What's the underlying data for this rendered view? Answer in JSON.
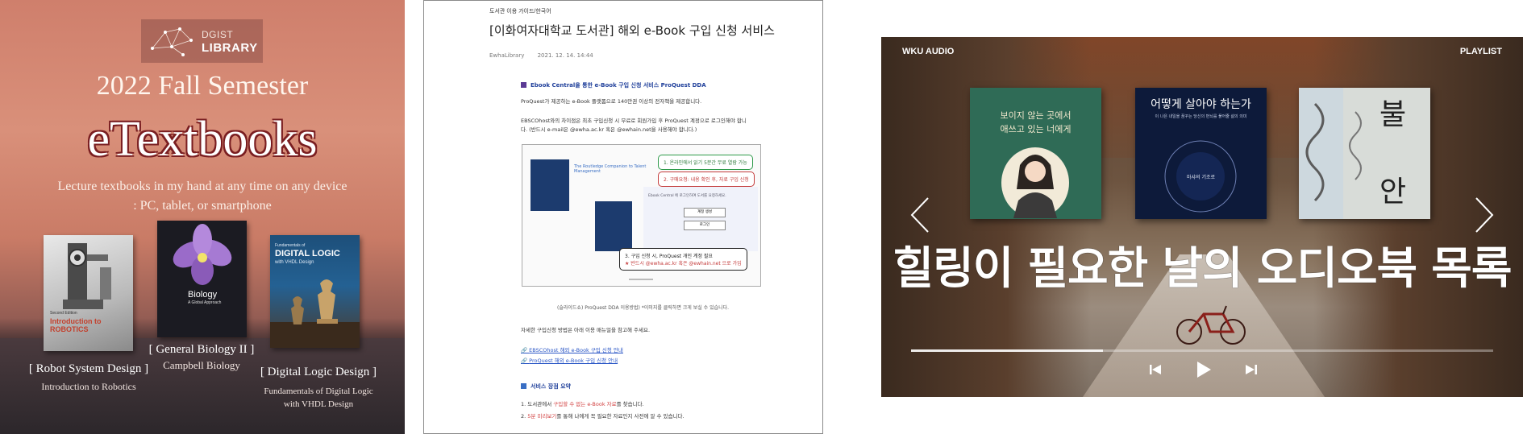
{
  "panel1": {
    "logo": {
      "line1": "DGIST",
      "line2": "LIBRARY"
    },
    "semester": "2022 Fall Semester",
    "heading": "eTextbooks",
    "subtitle_line1": "Lecture textbooks in my hand at any time on any device",
    "subtitle_line2": ": PC, tablet, or smartphone",
    "books": [
      {
        "label": "[ Robot System Design ]",
        "caption": "Introduction to Robotics",
        "cover_title": "Introduction to ROBOTICS",
        "cover_top": "Second Edition"
      },
      {
        "label": "[ General Biology II ]",
        "caption": "Campbell Biology",
        "cover_title": "Biology",
        "cover_sub": "A Global Approach"
      },
      {
        "label": "[ Digital Logic Design ]",
        "caption_line1": "Fundamentals of Digital Logic",
        "caption_line2": "with VHDL Design",
        "cover_title": "DIGITAL LOGIC",
        "cover_top": "Fundamentals of",
        "cover_sub": "with VHDL Design"
      }
    ]
  },
  "panel2": {
    "breadcrumb": "도서관 이용 가이드/한국어",
    "title": "[이화여자대학교 도서관] 해외 e-Book 구입 신청 서비스",
    "author": "EwhaLibrary",
    "date": "2021. 12. 14. 14:44",
    "section_heading": "Ebook Central을 통한 e-Book 구입 신청 서비스",
    "section_heading_brand": "ProQuest DDA",
    "para1": "ProQuest가 제공하는 e-Book 플랫폼으로 140만권 이상의 전자책을 제공합니다.",
    "para2_line1": "EBSCOhost와의 차이점은 최초 구입신청 시 무료로 회원가입 후 ProQuest 계정으로 로그인해야 합니",
    "para2_line2": "다. (반드시 e-mail은 @ewha.ac.kr 혹은 @ewhain.net을 사용해야 합니다.)",
    "figure": {
      "book_title": "The Routledge Companion to Talent Management",
      "callout1": "1. 온라인에서 읽기 5분간 무료 열람 가능",
      "callout2": "2. 구매요청: 내용 확인 후, 자료 구입 신청",
      "callout3_line1": "3. 구입 신청 시, ProQuest 개인 계정 필요",
      "callout3_line2": "★ 반드시 @ewha.ac.kr 혹은 @ewhain.net 으로 가입",
      "login_note": "Ebook Central 에 로그인하여 도서를 요청하세요.",
      "btn_login": "계정 생성",
      "btn_signup": "로그인"
    },
    "caption": "(슬라이드쇼) ProQuest DDA 이용방법) *이미지를 클릭하면 크게 보실 수 있습니다.",
    "more": "자세한 구입신청 방법은 아래 이용 매뉴얼을 참고해 주세요.",
    "link1": "EBSCOhost 해외 e-Book 구입 신청 안내",
    "link2": "ProQuest 해외 e-Book 구입 신청 안내",
    "summary_heading": "서비스 장점 요약",
    "summary1_a": "1. 도서관에서 ",
    "summary1_b": "구입할 수 없는 e-Book 자료",
    "summary1_c": "를 찾습니다.",
    "summary2_a": "2. ",
    "summary2_b": "5분 미리보기",
    "summary2_c": "를 통해 나에게 꼭 필요한 자료인지 사전에 알 수 있습니다."
  },
  "panel3": {
    "brand": "WKU AUDIO",
    "playlist": "PLAYLIST",
    "heading": "힐링이 필요한 날의 오디오북 목록",
    "covers": [
      {
        "line1": "보이지 않는 곳에서",
        "line2": "애쓰고 있는 너에게"
      },
      {
        "title": "어떻게 살아야 하는가",
        "sub": "이 나은 내일을 꿈꾸는 당신의 번뇌를 풀어줄 삶의 의미",
        "author": "마샤의 기조로"
      },
      {
        "title_top": "불",
        "title_bottom": "안"
      }
    ],
    "progress": 0.33,
    "colors": {
      "accent": "#ffffff"
    }
  }
}
